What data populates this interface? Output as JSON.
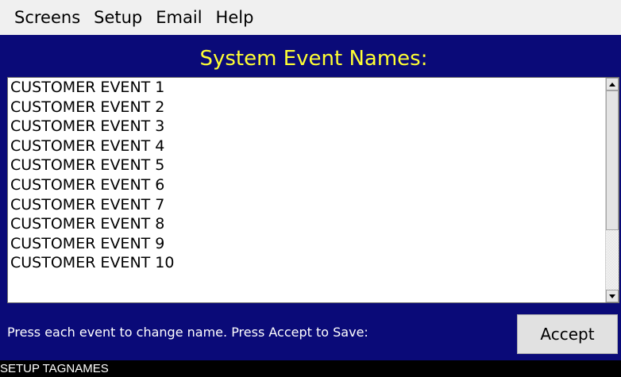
{
  "menu": {
    "items": [
      {
        "label": "Screens"
      },
      {
        "label": "Setup"
      },
      {
        "label": "Email"
      },
      {
        "label": "Help"
      }
    ]
  },
  "title": "System Event Names:",
  "events": {
    "items": [
      "CUSTOMER EVENT 1",
      "CUSTOMER EVENT 2",
      "CUSTOMER EVENT 3",
      "CUSTOMER EVENT 4",
      "CUSTOMER EVENT 5",
      "CUSTOMER EVENT 6",
      "CUSTOMER EVENT 7",
      "CUSTOMER EVENT 8",
      "CUSTOMER EVENT 9",
      "CUSTOMER EVENT 10"
    ]
  },
  "instruction": "Press each event to change name. Press Accept to Save:",
  "accept_label": "Accept",
  "status": "SETUP TAGNAMES",
  "colors": {
    "panel_background": "#0a0a78",
    "title_color": "#ffff33",
    "menubar_background": "#f0f0f0",
    "statusbar_background": "#000000"
  },
  "icons": {
    "scroll_up": "triangle-up-icon",
    "scroll_down": "triangle-down-icon"
  }
}
